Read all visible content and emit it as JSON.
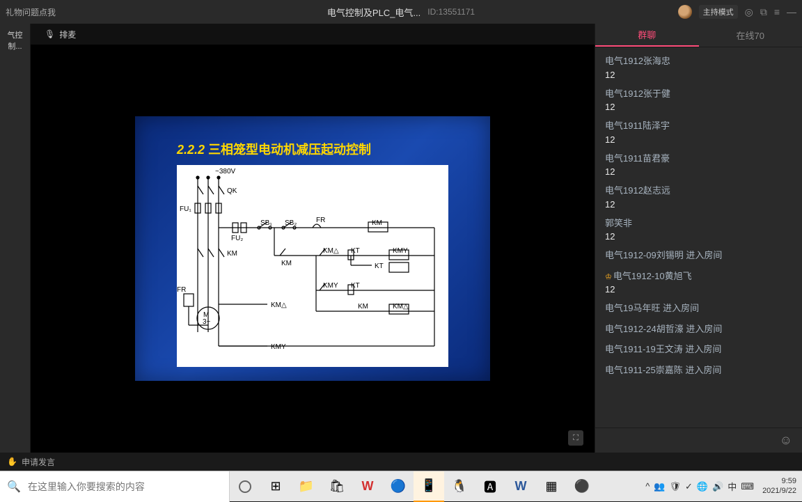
{
  "topbar": {
    "gift": "礼物问题点我",
    "title": "电气控制及PLC_电气...",
    "id_label": "ID:",
    "id_value": "13551171",
    "host_mode": "主持模式"
  },
  "left_tab": "气控制...",
  "mic_row": "排麦",
  "slide": {
    "section_num": "2.2.2",
    "section_title": "三相笼型电动机减压起动控制",
    "voltage": "~380V",
    "labels": {
      "FU1": "FU₁",
      "QK": "QK",
      "FU2": "FU₂",
      "SB1": "SB₁",
      "SB2": "SB₂",
      "FR": "FR",
      "KM": "KM",
      "KMD": "KM△",
      "KMY": "KMY",
      "KT": "KT",
      "M": "M\n3~"
    }
  },
  "tabs": {
    "chat": "群聊",
    "online": "在线70"
  },
  "chat": [
    {
      "name": "电气1912张海忠",
      "body": "12"
    },
    {
      "name": "电气1912张于健",
      "body": "12"
    },
    {
      "name": "电气1911陆泽宇",
      "body": "12"
    },
    {
      "name": "电气1911苗君豪",
      "body": "12"
    },
    {
      "name": "电气1912赵志远",
      "body": "12"
    },
    {
      "name": "郭笑非",
      "body": "12"
    },
    {
      "name": "电气1912-09刘锡明 进入房间",
      "body": "",
      "system": true
    },
    {
      "name": "电气1912-10黄旭飞",
      "body": "12",
      "crown": true
    },
    {
      "name": "电气19马年旺 进入房间",
      "body": "",
      "system": true
    },
    {
      "name": "电气1912-24胡哲濠 进入房间",
      "body": "",
      "system": true
    },
    {
      "name": "电气1911-19王文涛 进入房间",
      "body": "",
      "system": true
    },
    {
      "name": "电气1911-25崇嘉陈 进入房间",
      "body": "",
      "system": true
    }
  ],
  "speak": "申请发言",
  "search_placeholder": "在这里输入你要搜索的内容",
  "clock": {
    "time": "9:59",
    "date": "2021/9/22"
  },
  "tray_lang": "中"
}
